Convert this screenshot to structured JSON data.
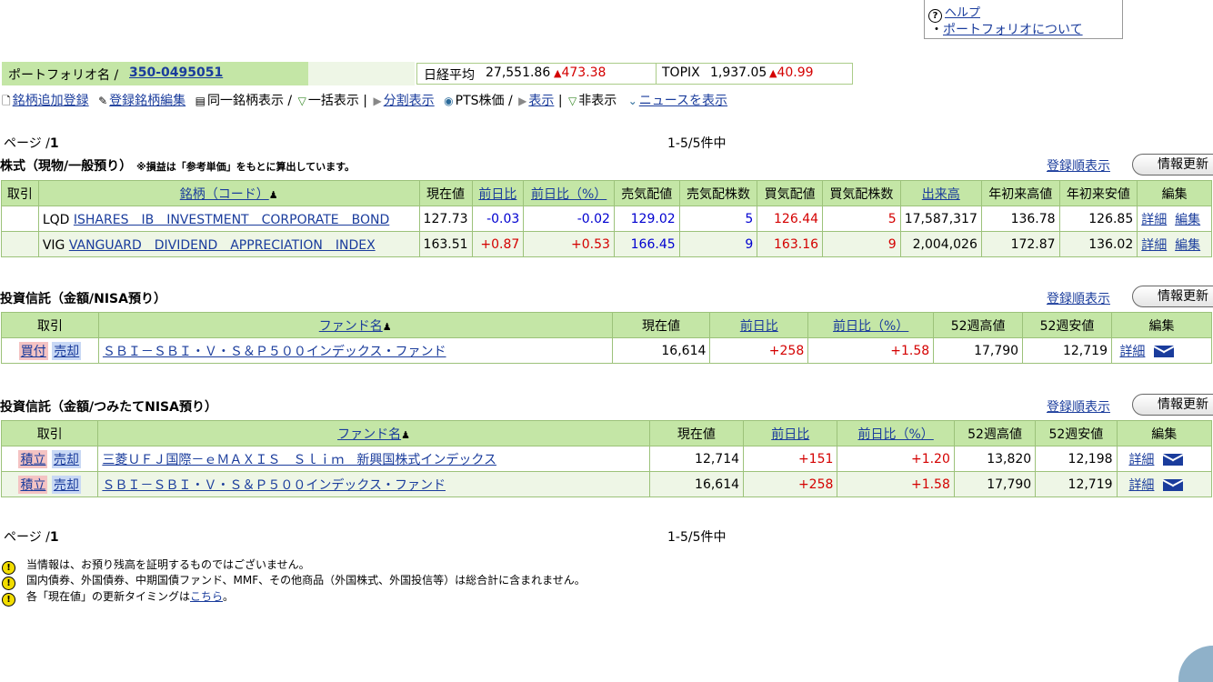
{
  "help": {
    "help_label": "ヘルプ",
    "about_label": "ポートフォリオについて"
  },
  "portfolio": {
    "name_label": "ポートフォリオ名 /",
    "name_value": "350-0495051"
  },
  "index": {
    "nikkei_label": "日経平均",
    "nikkei_value": "27,551.86",
    "nikkei_change": "473.38",
    "topix_label": "TOPIX",
    "topix_value": "1,937.05",
    "topix_change": "40.99"
  },
  "actions": {
    "add": "銘柄追加登録",
    "edit": "登録銘柄編集",
    "same": "同一銘柄表示 /",
    "bulk": "一括表示 |",
    "split": "分割表示",
    "pts": "PTS株価 /",
    "show": "表示",
    "sep": "|",
    "hide": "非表示",
    "news": "ニュースを表示"
  },
  "pager": {
    "page_label": "ページ /",
    "page_num": "1",
    "count": "1-5/5件中"
  },
  "stocks": {
    "title": "株式（現物/一般預り）",
    "note": "※損益は「参考単価」をもとに算出しています。",
    "order_label": "登録順表示",
    "refresh_label": "情報更新",
    "headers": [
      "取引",
      "銘柄（コード）",
      "現在値",
      "前日比",
      "前日比（%）",
      "売気配値",
      "売気配株数",
      "買気配値",
      "買気配株数",
      "出来高",
      "年初来高値",
      "年初来安値",
      "編集"
    ],
    "rows": [
      {
        "code": "LQD",
        "name": "ISHARES　IB　INVESTMENT　CORPORATE　BOND",
        "price": "127.73",
        "chg": "-0.03",
        "pct": "-0.02",
        "ask": "129.02",
        "askq": "5",
        "bid": "126.44",
        "bidq": "5",
        "vol": "17,587,317",
        "hi": "136.78",
        "lo": "126.85",
        "detail": "詳細",
        "edit": "編集"
      },
      {
        "code": "VIG",
        "name": "VANGUARD　DIVIDEND　APPRECIATION　INDEX",
        "price": "163.51",
        "chg": "+0.87",
        "pct": "+0.53",
        "ask": "166.45",
        "askq": "9",
        "bid": "163.16",
        "bidq": "9",
        "vol": "2,004,026",
        "hi": "172.87",
        "lo": "136.02",
        "detail": "詳細",
        "edit": "編集"
      }
    ]
  },
  "fund_nisa": {
    "title": "投資信託（金額/NISA預り）",
    "order_label": "登録順表示",
    "refresh_label": "情報更新",
    "headers": [
      "取引",
      "ファンド名",
      "現在値",
      "前日比",
      "前日比（%）",
      "52週高値",
      "52週安値",
      "編集"
    ],
    "rows": [
      {
        "buy": "買付",
        "sell": "売却",
        "name": "ＳＢＩ－ＳＢＩ・Ｖ・Ｓ＆Ｐ５００インデックス・ファンド",
        "price": "16,614",
        "chg": "+258",
        "pct": "+1.58",
        "hi": "17,790",
        "lo": "12,719",
        "detail": "詳細"
      }
    ]
  },
  "fund_tsumitate": {
    "title": "投資信託（金額/つみたてNISA預り）",
    "order_label": "登録順表示",
    "refresh_label": "情報更新",
    "headers": [
      "取引",
      "ファンド名",
      "現在値",
      "前日比",
      "前日比（%）",
      "52週高値",
      "52週安値",
      "編集"
    ],
    "rows": [
      {
        "buy": "積立",
        "sell": "売却",
        "name": "三菱ＵＦＪ国際－ｅＭＡＸＩＳ　Ｓｌｉｍ　新興国株式インデックス",
        "price": "12,714",
        "chg": "+151",
        "pct": "+1.20",
        "hi": "13,820",
        "lo": "12,198",
        "detail": "詳細"
      },
      {
        "buy": "積立",
        "sell": "売却",
        "name": "ＳＢＩ－ＳＢＩ・Ｖ・Ｓ＆Ｐ５００インデックス・ファンド",
        "price": "16,614",
        "chg": "+258",
        "pct": "+1.58",
        "hi": "17,790",
        "lo": "12,719",
        "detail": "詳細"
      }
    ]
  },
  "notes": {
    "n1": "当情報は、お預り残高を証明するものではございません。",
    "n2": "国内債券、外国債券、中期国債ファンド、MMF、その他商品（外国株式、外国投信等）は総合計に含まれません。",
    "n3_prefix": "各「現在値」の更新タイミングは",
    "n3_link": "こちら",
    "n3_suffix": "。"
  }
}
